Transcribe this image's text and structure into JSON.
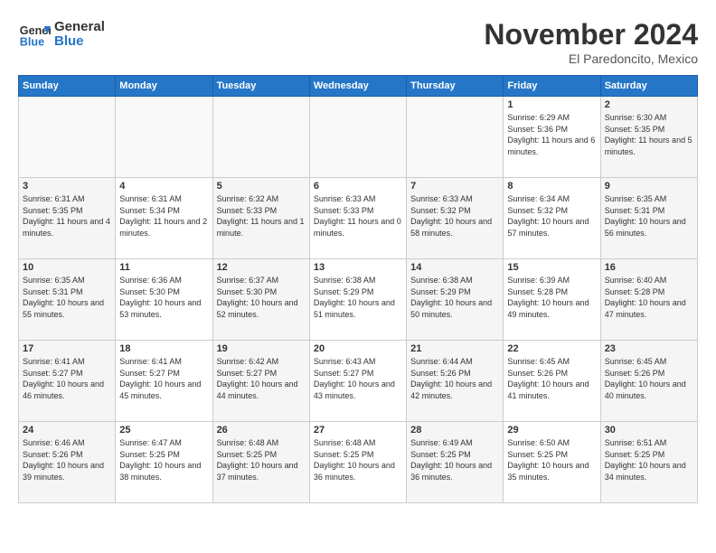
{
  "header": {
    "logo_line1": "General",
    "logo_line2": "Blue",
    "month": "November 2024",
    "location": "El Paredoncito, Mexico"
  },
  "weekdays": [
    "Sunday",
    "Monday",
    "Tuesday",
    "Wednesday",
    "Thursday",
    "Friday",
    "Saturday"
  ],
  "weeks": [
    [
      {
        "day": "",
        "info": ""
      },
      {
        "day": "",
        "info": ""
      },
      {
        "day": "",
        "info": ""
      },
      {
        "day": "",
        "info": ""
      },
      {
        "day": "",
        "info": ""
      },
      {
        "day": "1",
        "info": "Sunrise: 6:29 AM\nSunset: 5:36 PM\nDaylight: 11 hours and 6 minutes."
      },
      {
        "day": "2",
        "info": "Sunrise: 6:30 AM\nSunset: 5:35 PM\nDaylight: 11 hours and 5 minutes."
      }
    ],
    [
      {
        "day": "3",
        "info": "Sunrise: 6:31 AM\nSunset: 5:35 PM\nDaylight: 11 hours and 4 minutes."
      },
      {
        "day": "4",
        "info": "Sunrise: 6:31 AM\nSunset: 5:34 PM\nDaylight: 11 hours and 2 minutes."
      },
      {
        "day": "5",
        "info": "Sunrise: 6:32 AM\nSunset: 5:33 PM\nDaylight: 11 hours and 1 minute."
      },
      {
        "day": "6",
        "info": "Sunrise: 6:33 AM\nSunset: 5:33 PM\nDaylight: 11 hours and 0 minutes."
      },
      {
        "day": "7",
        "info": "Sunrise: 6:33 AM\nSunset: 5:32 PM\nDaylight: 10 hours and 58 minutes."
      },
      {
        "day": "8",
        "info": "Sunrise: 6:34 AM\nSunset: 5:32 PM\nDaylight: 10 hours and 57 minutes."
      },
      {
        "day": "9",
        "info": "Sunrise: 6:35 AM\nSunset: 5:31 PM\nDaylight: 10 hours and 56 minutes."
      }
    ],
    [
      {
        "day": "10",
        "info": "Sunrise: 6:35 AM\nSunset: 5:31 PM\nDaylight: 10 hours and 55 minutes."
      },
      {
        "day": "11",
        "info": "Sunrise: 6:36 AM\nSunset: 5:30 PM\nDaylight: 10 hours and 53 minutes."
      },
      {
        "day": "12",
        "info": "Sunrise: 6:37 AM\nSunset: 5:30 PM\nDaylight: 10 hours and 52 minutes."
      },
      {
        "day": "13",
        "info": "Sunrise: 6:38 AM\nSunset: 5:29 PM\nDaylight: 10 hours and 51 minutes."
      },
      {
        "day": "14",
        "info": "Sunrise: 6:38 AM\nSunset: 5:29 PM\nDaylight: 10 hours and 50 minutes."
      },
      {
        "day": "15",
        "info": "Sunrise: 6:39 AM\nSunset: 5:28 PM\nDaylight: 10 hours and 49 minutes."
      },
      {
        "day": "16",
        "info": "Sunrise: 6:40 AM\nSunset: 5:28 PM\nDaylight: 10 hours and 47 minutes."
      }
    ],
    [
      {
        "day": "17",
        "info": "Sunrise: 6:41 AM\nSunset: 5:27 PM\nDaylight: 10 hours and 46 minutes."
      },
      {
        "day": "18",
        "info": "Sunrise: 6:41 AM\nSunset: 5:27 PM\nDaylight: 10 hours and 45 minutes."
      },
      {
        "day": "19",
        "info": "Sunrise: 6:42 AM\nSunset: 5:27 PM\nDaylight: 10 hours and 44 minutes."
      },
      {
        "day": "20",
        "info": "Sunrise: 6:43 AM\nSunset: 5:27 PM\nDaylight: 10 hours and 43 minutes."
      },
      {
        "day": "21",
        "info": "Sunrise: 6:44 AM\nSunset: 5:26 PM\nDaylight: 10 hours and 42 minutes."
      },
      {
        "day": "22",
        "info": "Sunrise: 6:45 AM\nSunset: 5:26 PM\nDaylight: 10 hours and 41 minutes."
      },
      {
        "day": "23",
        "info": "Sunrise: 6:45 AM\nSunset: 5:26 PM\nDaylight: 10 hours and 40 minutes."
      }
    ],
    [
      {
        "day": "24",
        "info": "Sunrise: 6:46 AM\nSunset: 5:26 PM\nDaylight: 10 hours and 39 minutes."
      },
      {
        "day": "25",
        "info": "Sunrise: 6:47 AM\nSunset: 5:25 PM\nDaylight: 10 hours and 38 minutes."
      },
      {
        "day": "26",
        "info": "Sunrise: 6:48 AM\nSunset: 5:25 PM\nDaylight: 10 hours and 37 minutes."
      },
      {
        "day": "27",
        "info": "Sunrise: 6:48 AM\nSunset: 5:25 PM\nDaylight: 10 hours and 36 minutes."
      },
      {
        "day": "28",
        "info": "Sunrise: 6:49 AM\nSunset: 5:25 PM\nDaylight: 10 hours and 36 minutes."
      },
      {
        "day": "29",
        "info": "Sunrise: 6:50 AM\nSunset: 5:25 PM\nDaylight: 10 hours and 35 minutes."
      },
      {
        "day": "30",
        "info": "Sunrise: 6:51 AM\nSunset: 5:25 PM\nDaylight: 10 hours and 34 minutes."
      }
    ]
  ]
}
